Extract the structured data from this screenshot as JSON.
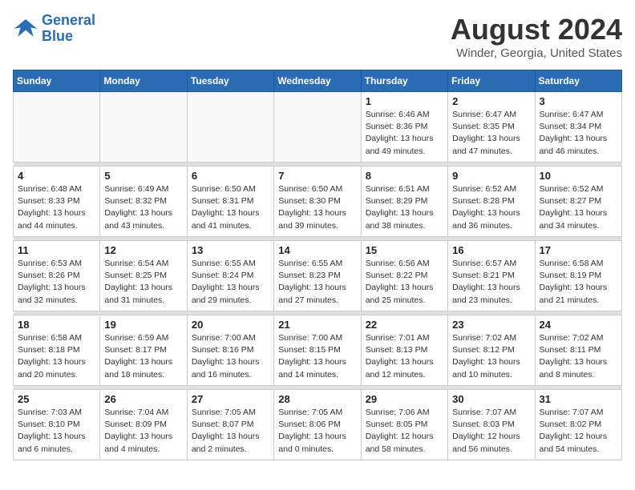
{
  "header": {
    "logo_line1": "General",
    "logo_line2": "Blue",
    "main_title": "August 2024",
    "subtitle": "Winder, Georgia, United States"
  },
  "calendar": {
    "days_of_week": [
      "Sunday",
      "Monday",
      "Tuesday",
      "Wednesday",
      "Thursday",
      "Friday",
      "Saturday"
    ],
    "weeks": [
      [
        {
          "day": "",
          "info": ""
        },
        {
          "day": "",
          "info": ""
        },
        {
          "day": "",
          "info": ""
        },
        {
          "day": "",
          "info": ""
        },
        {
          "day": "1",
          "info": "Sunrise: 6:46 AM\nSunset: 8:36 PM\nDaylight: 13 hours\nand 49 minutes."
        },
        {
          "day": "2",
          "info": "Sunrise: 6:47 AM\nSunset: 8:35 PM\nDaylight: 13 hours\nand 47 minutes."
        },
        {
          "day": "3",
          "info": "Sunrise: 6:47 AM\nSunset: 8:34 PM\nDaylight: 13 hours\nand 46 minutes."
        }
      ],
      [
        {
          "day": "4",
          "info": "Sunrise: 6:48 AM\nSunset: 8:33 PM\nDaylight: 13 hours\nand 44 minutes."
        },
        {
          "day": "5",
          "info": "Sunrise: 6:49 AM\nSunset: 8:32 PM\nDaylight: 13 hours\nand 43 minutes."
        },
        {
          "day": "6",
          "info": "Sunrise: 6:50 AM\nSunset: 8:31 PM\nDaylight: 13 hours\nand 41 minutes."
        },
        {
          "day": "7",
          "info": "Sunrise: 6:50 AM\nSunset: 8:30 PM\nDaylight: 13 hours\nand 39 minutes."
        },
        {
          "day": "8",
          "info": "Sunrise: 6:51 AM\nSunset: 8:29 PM\nDaylight: 13 hours\nand 38 minutes."
        },
        {
          "day": "9",
          "info": "Sunrise: 6:52 AM\nSunset: 8:28 PM\nDaylight: 13 hours\nand 36 minutes."
        },
        {
          "day": "10",
          "info": "Sunrise: 6:52 AM\nSunset: 8:27 PM\nDaylight: 13 hours\nand 34 minutes."
        }
      ],
      [
        {
          "day": "11",
          "info": "Sunrise: 6:53 AM\nSunset: 8:26 PM\nDaylight: 13 hours\nand 32 minutes."
        },
        {
          "day": "12",
          "info": "Sunrise: 6:54 AM\nSunset: 8:25 PM\nDaylight: 13 hours\nand 31 minutes."
        },
        {
          "day": "13",
          "info": "Sunrise: 6:55 AM\nSunset: 8:24 PM\nDaylight: 13 hours\nand 29 minutes."
        },
        {
          "day": "14",
          "info": "Sunrise: 6:55 AM\nSunset: 8:23 PM\nDaylight: 13 hours\nand 27 minutes."
        },
        {
          "day": "15",
          "info": "Sunrise: 6:56 AM\nSunset: 8:22 PM\nDaylight: 13 hours\nand 25 minutes."
        },
        {
          "day": "16",
          "info": "Sunrise: 6:57 AM\nSunset: 8:21 PM\nDaylight: 13 hours\nand 23 minutes."
        },
        {
          "day": "17",
          "info": "Sunrise: 6:58 AM\nSunset: 8:19 PM\nDaylight: 13 hours\nand 21 minutes."
        }
      ],
      [
        {
          "day": "18",
          "info": "Sunrise: 6:58 AM\nSunset: 8:18 PM\nDaylight: 13 hours\nand 20 minutes."
        },
        {
          "day": "19",
          "info": "Sunrise: 6:59 AM\nSunset: 8:17 PM\nDaylight: 13 hours\nand 18 minutes."
        },
        {
          "day": "20",
          "info": "Sunrise: 7:00 AM\nSunset: 8:16 PM\nDaylight: 13 hours\nand 16 minutes."
        },
        {
          "day": "21",
          "info": "Sunrise: 7:00 AM\nSunset: 8:15 PM\nDaylight: 13 hours\nand 14 minutes."
        },
        {
          "day": "22",
          "info": "Sunrise: 7:01 AM\nSunset: 8:13 PM\nDaylight: 13 hours\nand 12 minutes."
        },
        {
          "day": "23",
          "info": "Sunrise: 7:02 AM\nSunset: 8:12 PM\nDaylight: 13 hours\nand 10 minutes."
        },
        {
          "day": "24",
          "info": "Sunrise: 7:02 AM\nSunset: 8:11 PM\nDaylight: 13 hours\nand 8 minutes."
        }
      ],
      [
        {
          "day": "25",
          "info": "Sunrise: 7:03 AM\nSunset: 8:10 PM\nDaylight: 13 hours\nand 6 minutes."
        },
        {
          "day": "26",
          "info": "Sunrise: 7:04 AM\nSunset: 8:09 PM\nDaylight: 13 hours\nand 4 minutes."
        },
        {
          "day": "27",
          "info": "Sunrise: 7:05 AM\nSunset: 8:07 PM\nDaylight: 13 hours\nand 2 minutes."
        },
        {
          "day": "28",
          "info": "Sunrise: 7:05 AM\nSunset: 8:06 PM\nDaylight: 13 hours\nand 0 minutes."
        },
        {
          "day": "29",
          "info": "Sunrise: 7:06 AM\nSunset: 8:05 PM\nDaylight: 12 hours\nand 58 minutes."
        },
        {
          "day": "30",
          "info": "Sunrise: 7:07 AM\nSunset: 8:03 PM\nDaylight: 12 hours\nand 56 minutes."
        },
        {
          "day": "31",
          "info": "Sunrise: 7:07 AM\nSunset: 8:02 PM\nDaylight: 12 hours\nand 54 minutes."
        }
      ]
    ]
  }
}
